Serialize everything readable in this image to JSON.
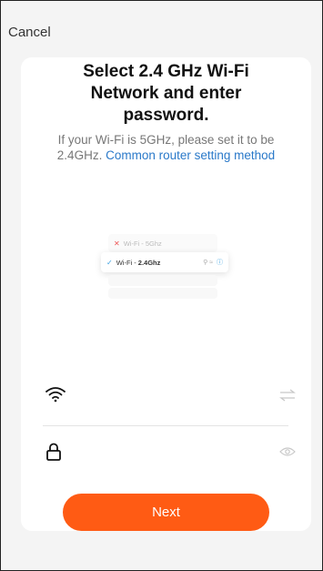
{
  "header": {
    "cancel_label": "Cancel"
  },
  "main": {
    "title": "Select 2.4 GHz Wi-Fi Network and enter password.",
    "subtitle_text": "If your Wi-Fi is 5GHz, please set it to be 2.4GHz.",
    "subtitle_link": "Common router setting method"
  },
  "illustration": {
    "row_5g_label": "Wi-Fi - 5Ghz",
    "row_24g_prefix": "Wi-Fi - ",
    "row_24g_bold": "2.4Ghz"
  },
  "form": {
    "ssid_icon": "wifi-icon",
    "switch_icon": "switch-network-icon",
    "password_icon": "lock-icon",
    "visibility_icon": "eye-icon"
  },
  "footer": {
    "next_label": "Next"
  },
  "colors": {
    "accent": "#ff5b14",
    "link": "#2a79c9"
  }
}
